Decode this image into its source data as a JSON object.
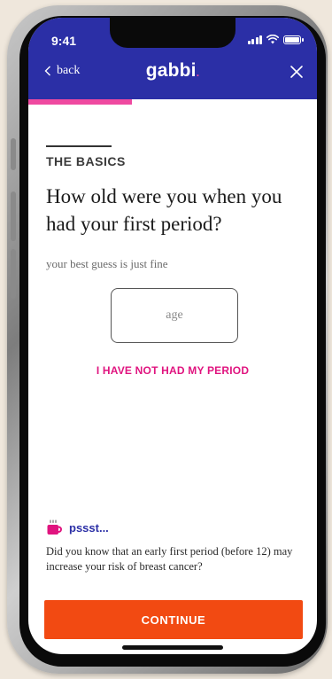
{
  "status": {
    "time": "9:41"
  },
  "nav": {
    "back_label": "back",
    "logo": "gabbi",
    "close_icon": "close-icon",
    "back_icon": "chevron-left-icon"
  },
  "progress": {
    "fraction": 0.36,
    "color": "#ef4aa0"
  },
  "section": {
    "title": "THE BASICS"
  },
  "question": {
    "text": "How old were you when you had your first period?",
    "hint": "your best guess is just fine"
  },
  "age_field": {
    "value": "",
    "placeholder": "age"
  },
  "no_period_link": "I HAVE NOT HAD MY PERIOD",
  "tip": {
    "icon": "coffee-cup-icon",
    "label": "pssst...",
    "text": "Did you know that an early first period (before 12) may increase your risk of breast cancer?"
  },
  "continue_label": "CONTINUE",
  "colors": {
    "header": "#2b2fa6",
    "accent_pink": "#e0147f",
    "continue": "#f24a12",
    "background": "#efe7dc"
  }
}
